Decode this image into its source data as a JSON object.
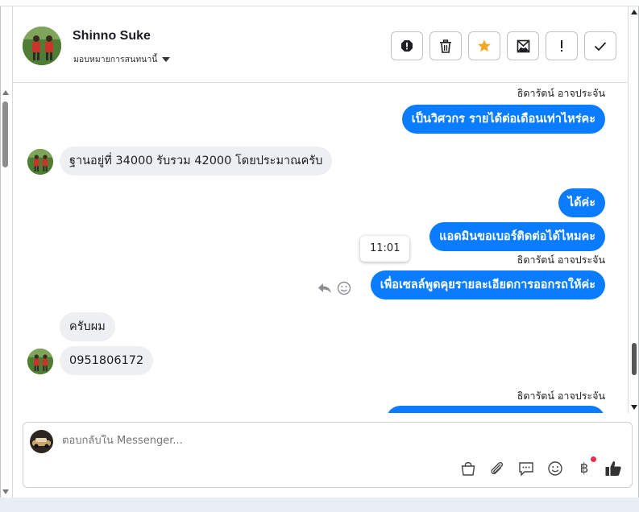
{
  "header": {
    "contact_name": "Shinno Suke",
    "assign_label": "มอบหมายการสนทนานี้"
  },
  "actions": [
    {
      "name": "report-icon",
      "label": "!"
    },
    {
      "name": "trash-icon"
    },
    {
      "name": "star-icon",
      "color": "#f5a524"
    },
    {
      "name": "mark-unread-icon"
    },
    {
      "name": "mark-spam-icon",
      "label": "!"
    },
    {
      "name": "done-check-icon"
    }
  ],
  "messages": {
    "m1_sender": "ธิดารัตน์ อาจประจัน",
    "m1_text": "เป็นวิศวกร รายได้ต่อเดือนเท่าไหร่คะ",
    "m2_text": "ฐานอยู่ที่ 34000 รับรวม 42000 โดยประมาณครับ",
    "m3_text": "ได้ค่ะ",
    "m4_text": "แอดมินขอเบอร์ติดต่อได้ไหมคะ",
    "m5_sender": "ธิดารัตน์ อาจประจัน",
    "m5_text": "เพื่อเซลล์พูดคุยรายละเอียดการออกรถให้ค่ะ",
    "tooltip_time": "11:01",
    "m6_text": "ครับผม",
    "m7_text": "0951806172",
    "m8_sender": "ธิดารัตน์ อาจประจัน"
  },
  "composer": {
    "placeholder": "ตอบกลับใน Messenger...",
    "tools": [
      "bag-icon",
      "paperclip-icon",
      "quick-reply-icon",
      "emoji-icon",
      "baht-icon",
      "thumbs-up-icon"
    ],
    "baht_symbol": "฿"
  },
  "colors": {
    "outgoing_bubble": "#0a7cff",
    "incoming_bubble": "#eeeff1",
    "star": "#f5a524"
  }
}
